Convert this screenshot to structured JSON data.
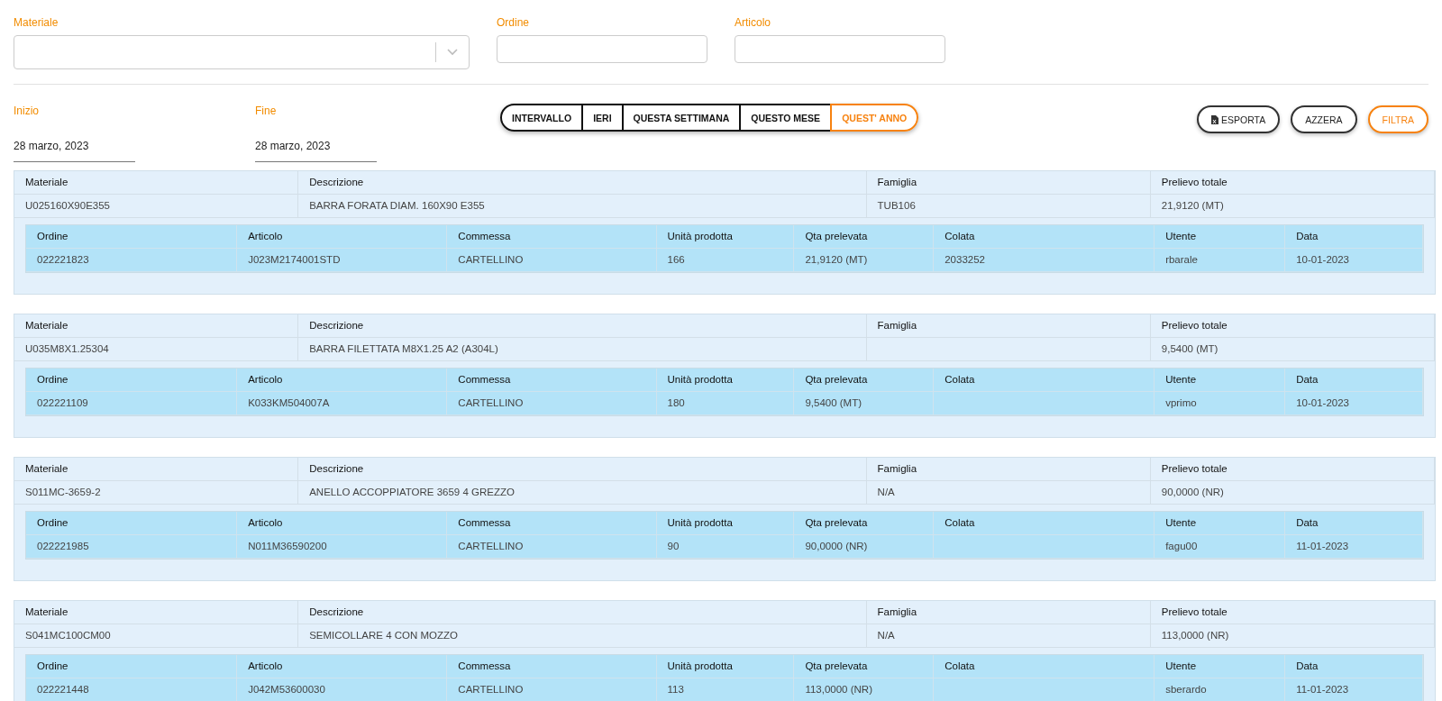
{
  "filters": {
    "materiale": {
      "label": "Materiale"
    },
    "ordine": {
      "label": "Ordine"
    },
    "articolo": {
      "label": "Articolo"
    }
  },
  "dates": [
    {
      "label": "Inizio",
      "value": "28 marzo, 2023"
    },
    {
      "label": "Fine",
      "value": "28 marzo, 2023"
    }
  ],
  "ranges": [
    {
      "label": "INTERVALLO",
      "selected": false
    },
    {
      "label": "IERI",
      "selected": false
    },
    {
      "label": "QUESTA SETTIMANA",
      "selected": false
    },
    {
      "label": "QUESTO MESE",
      "selected": false
    },
    {
      "label": "QUEST' ANNO",
      "selected": true
    }
  ],
  "actions": [
    {
      "label": "ESPORTA",
      "kind": "export"
    },
    {
      "label": "AZZERA",
      "kind": "plain"
    },
    {
      "label": "FILTRA",
      "kind": "primary"
    }
  ],
  "groups": [
    {
      "columns": [
        "Materiale",
        "Descrizione",
        "Famiglia",
        "Prelievo totale"
      ],
      "material": "U025160X90E355",
      "description": "BARRA FORATA DIAM. 160X90 E355",
      "family": "TUB106",
      "total": "21,9120 (MT)",
      "detail_columns": [
        "Ordine",
        "Articolo",
        "Commessa",
        "Unità prodotta",
        "Qta prelevata",
        "Colata",
        "Utente",
        "Data"
      ],
      "rows": [
        {
          "ordine": "022221823",
          "articolo": "J023M2174001STD",
          "commessa": "CARTELLINO",
          "unita": "166",
          "qta": "21,9120 (MT)",
          "colata": "2033252",
          "utente": "rbarale",
          "data": "10-01-2023"
        }
      ]
    },
    {
      "columns": [
        "Materiale",
        "Descrizione",
        "Famiglia",
        "Prelievo totale"
      ],
      "material": "U035M8X1.25304",
      "description": "BARRA FILETTATA M8X1.25 A2 (A304L)",
      "total": "9,5400 (MT)",
      "detail_columns": [
        "Ordine",
        "Articolo",
        "Commessa",
        "Unità prodotta",
        "Qta prelevata",
        "Colata",
        "Utente",
        "Data"
      ],
      "rows": [
        {
          "ordine": "022221109",
          "articolo": "K033KM504007A",
          "commessa": "CARTELLINO",
          "unita": "180",
          "qta": "9,5400 (MT)",
          "utente": "vprimo",
          "data": "10-01-2023"
        }
      ]
    },
    {
      "columns": [
        "Materiale",
        "Descrizione",
        "Famiglia",
        "Prelievo totale"
      ],
      "material": "S011MC-3659-2",
      "description": "ANELLO ACCOPPIATORE 3659 4 GREZZO",
      "family": "N/A",
      "total": "90,0000 (NR)",
      "detail_columns": [
        "Ordine",
        "Articolo",
        "Commessa",
        "Unità prodotta",
        "Qta prelevata",
        "Colata",
        "Utente",
        "Data"
      ],
      "rows": [
        {
          "ordine": "022221985",
          "articolo": "N011M36590200",
          "commessa": "CARTELLINO",
          "unita": "90",
          "qta": "90,0000 (NR)",
          "utente": "fagu00",
          "data": "11-01-2023"
        }
      ]
    },
    {
      "columns": [
        "Materiale",
        "Descrizione",
        "Famiglia",
        "Prelievo totale"
      ],
      "material": "S041MC100CM00",
      "description": "SEMICOLLARE 4 CON MOZZO",
      "family": "N/A",
      "total": "113,0000 (NR)",
      "detail_columns": [
        "Ordine",
        "Articolo",
        "Commessa",
        "Unità prodotta",
        "Qta prelevata",
        "Colata",
        "Utente",
        "Data"
      ],
      "rows": [
        {
          "ordine": "022221448",
          "articolo": "J042M53600030",
          "commessa": "CARTELLINO",
          "unita": "113",
          "qta": "113,0000 (NR)",
          "utente": "sberardo",
          "data": "11-01-2023"
        }
      ]
    }
  ]
}
